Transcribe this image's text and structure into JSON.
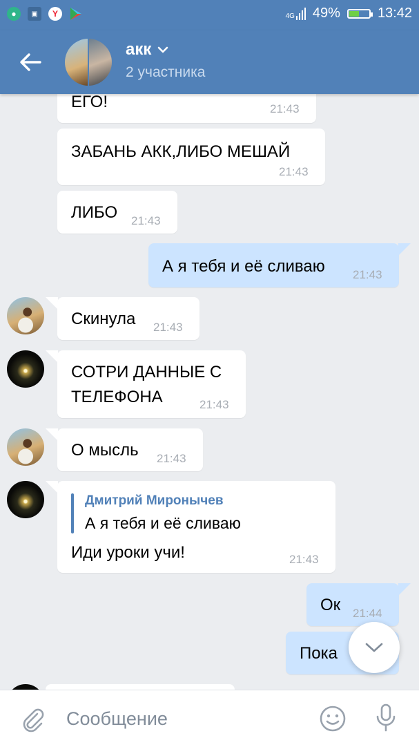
{
  "status_bar": {
    "network": "4G",
    "battery_percent": "49%",
    "battery_level": 0.49,
    "time": "13:42",
    "left_icons": [
      "chat-app-icon",
      "gallery-icon",
      "yandex-browser-icon",
      "play-store-icon"
    ]
  },
  "header": {
    "title": "акк",
    "subtitle": "2 участника"
  },
  "messages": [
    {
      "text": "ЕГО!",
      "time": "21:43"
    },
    {
      "text": "ЗАБАНЬ АКК,ЛИБО МЕШАЙ",
      "time": "21:43"
    },
    {
      "text": "ЛИБО",
      "time": "21:43"
    },
    {
      "text": "А я тебя и её сливаю",
      "time": "21:43"
    },
    {
      "text": "Скинула",
      "time": "21:43"
    },
    {
      "line1": "СОТРИ ДАННЫЕ С",
      "line2": "ТЕЛЕФОНА",
      "time": "21:43"
    },
    {
      "text": "О мысль",
      "time": "21:43"
    },
    {
      "reply_author": "Дмитрий Миронычев",
      "reply_text": "А я тебя и её сливаю",
      "text": "Иди уроки учи!",
      "time": "21:43"
    },
    {
      "text": "Ок",
      "time": "21:44"
    },
    {
      "text": "Пока"
    }
  ],
  "composer": {
    "placeholder": "Сообщение"
  },
  "colors": {
    "header": "#5181b8",
    "background": "#ebedf0",
    "outgoing_bubble": "#cce4ff",
    "incoming_bubble": "#ffffff",
    "time": "#a8adb4"
  }
}
